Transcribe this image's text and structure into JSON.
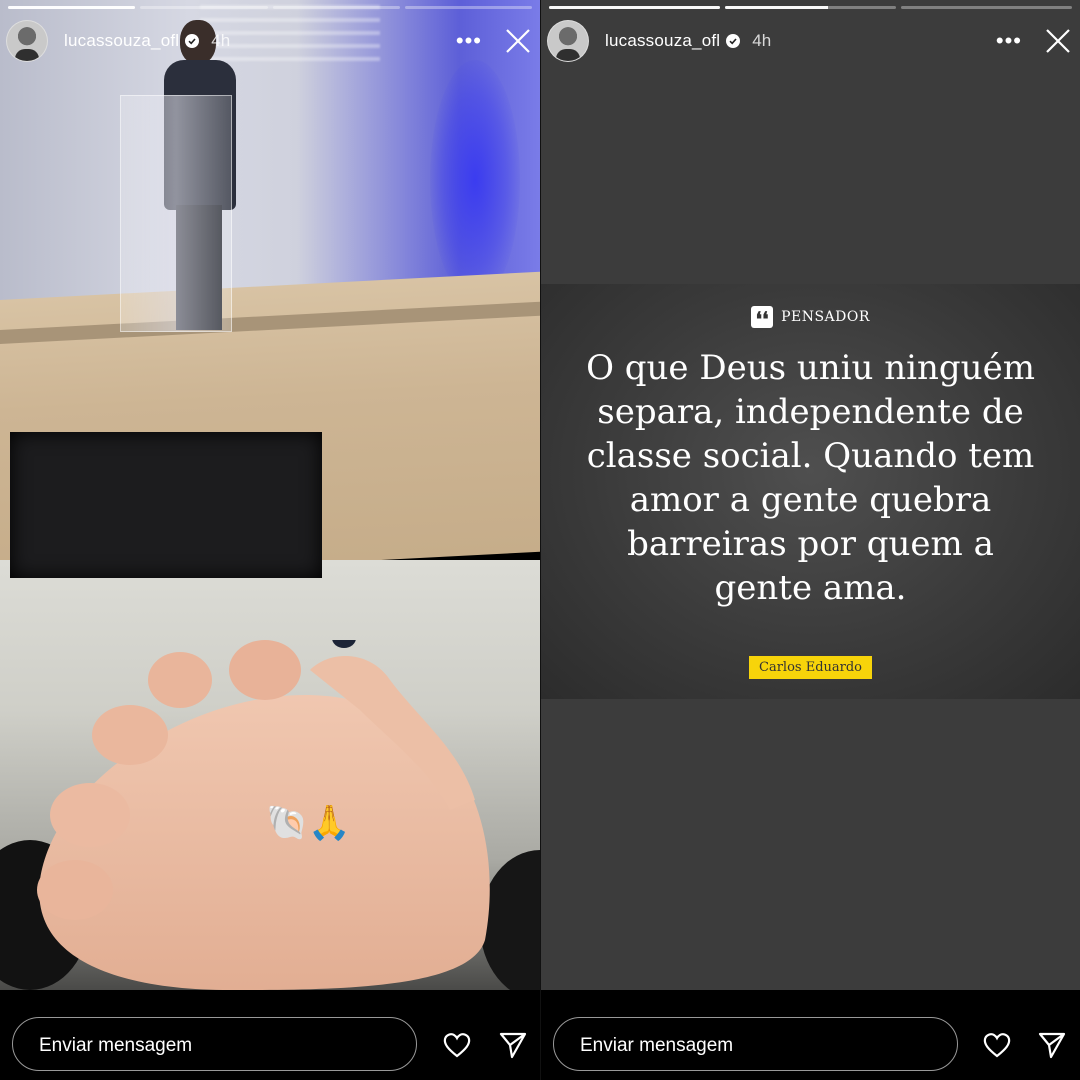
{
  "stories": [
    {
      "user": {
        "username": "lucassouza_ofl",
        "time": "4h",
        "verified": true
      },
      "progress": [
        1.0,
        0.0,
        0.0,
        0.0
      ],
      "stickers": "🐚🙏",
      "footer": {
        "message_placeholder": "Enviar mensagem"
      }
    },
    {
      "user": {
        "username": "lucassouza_ofl",
        "time": "4h",
        "verified": true
      },
      "progress": [
        1.0,
        0.6,
        0.0
      ],
      "quote": {
        "brand": "PENSADOR",
        "brand_logo": "❛❛",
        "lines": [
          "O que Deus uniu ninguém",
          "separa, independente de",
          "classe social. Quando tem",
          "amor a gente quebra",
          "barreiras por quem a",
          "gente ama."
        ],
        "author": "Carlos Eduardo"
      },
      "footer": {
        "message_placeholder": "Enviar mensagem"
      }
    }
  ],
  "colors": {
    "quote_author_bg": "#f7d40a",
    "quote_bg": "#3c3c3c"
  },
  "icons": {
    "more": "more-options-icon",
    "close": "close-icon",
    "like": "heart-icon",
    "share": "send-icon",
    "verified": "verified-badge-icon"
  }
}
